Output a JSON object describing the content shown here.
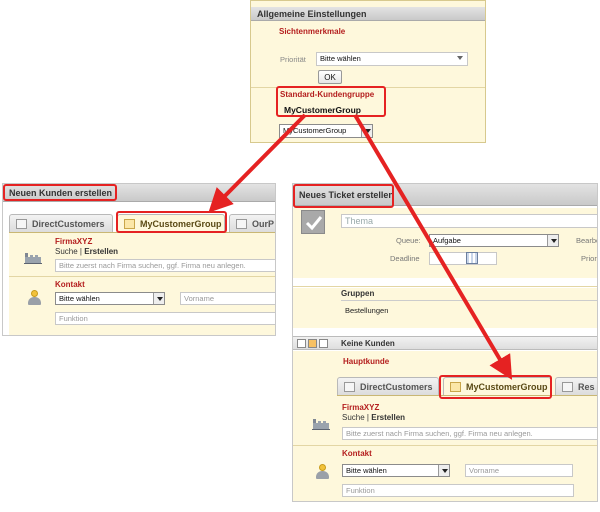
{
  "top_panel": {
    "header": "Allgemeine Einstellungen",
    "section1_title": "Sichtenmerkmale",
    "priority_label": "Priorität",
    "priority_value": "Bitte wählen",
    "ok_label": "OK",
    "section2_title": "Standard-Kundengruppe",
    "group_name": "MyCustomerGroup",
    "group_select_value": "MyCustomerGroup"
  },
  "left_panel": {
    "title": "Neuen Kunden erstellen",
    "tabs": [
      {
        "label": "DirectCustomers"
      },
      {
        "label": "MyCustomerGroup"
      },
      {
        "label": "OurP"
      }
    ],
    "company_name": "FirmaXYZ",
    "search_link": "Suche",
    "separator": "|",
    "create_link": "Erstellen",
    "company_hint": "Bitte zuerst nach Firma suchen, ggf. Firma neu anlegen.",
    "contact_title": "Kontakt",
    "salutation_value": "Bitte wählen",
    "firstname_placeholder": "Vorname",
    "function_placeholder": "Funktion"
  },
  "right_panel": {
    "title": "Neues Ticket erstellen",
    "subject_placeholder": "Thema",
    "queue_label": "Queue:",
    "queue_value": "Aufgabe",
    "editor_label": "Bearbeit",
    "deadline_label": "Deadline",
    "priority_label": "Prior",
    "groups_title": "Gruppen",
    "groups_value": "Bestellungen",
    "customers_title": "Keine Kunden",
    "main_customer_title": "Hauptkunde",
    "tabs": [
      {
        "label": "DirectCustomers"
      },
      {
        "label": "MyCustomerGroup"
      },
      {
        "label": "Res"
      }
    ],
    "company_name": "FirmaXYZ",
    "search_link": "Suche",
    "separator": "|",
    "create_link": "Erstellen",
    "company_hint": "Bitte zuerst nach Firma suchen, ggf. Firma neu anlegen.",
    "contact_title": "Kontakt",
    "salutation_value": "Bitte wählen",
    "firstname_placeholder": "Vorname",
    "function_placeholder": "Funktion"
  },
  "colors": {
    "highlight": "#e52222",
    "panel_bg": "#fef8dc",
    "section_title": "#b41e1e"
  }
}
